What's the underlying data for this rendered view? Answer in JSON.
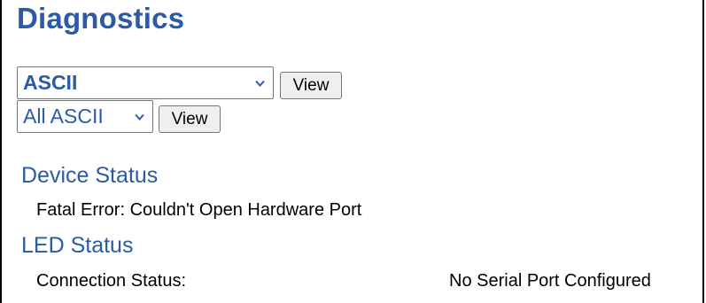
{
  "page": {
    "title": "Diagnostics"
  },
  "controls": {
    "protocol_select": {
      "value": "ASCII"
    },
    "view_button_1": {
      "label": "View"
    },
    "filter_select": {
      "value": "All ASCII"
    },
    "view_button_2": {
      "label": "View"
    }
  },
  "device_status": {
    "heading": "Device Status",
    "message": "Fatal Error: Couldn't Open Hardware Port"
  },
  "led_status": {
    "heading": "LED Status",
    "connection_label": "Connection Status:",
    "connection_value": "No Serial Port Configured"
  },
  "icons": {
    "dropdown": "chevron-down-icon"
  },
  "colors": {
    "heading": "#2b5ba6",
    "button_bg": "#efefef",
    "border": "#767676"
  }
}
